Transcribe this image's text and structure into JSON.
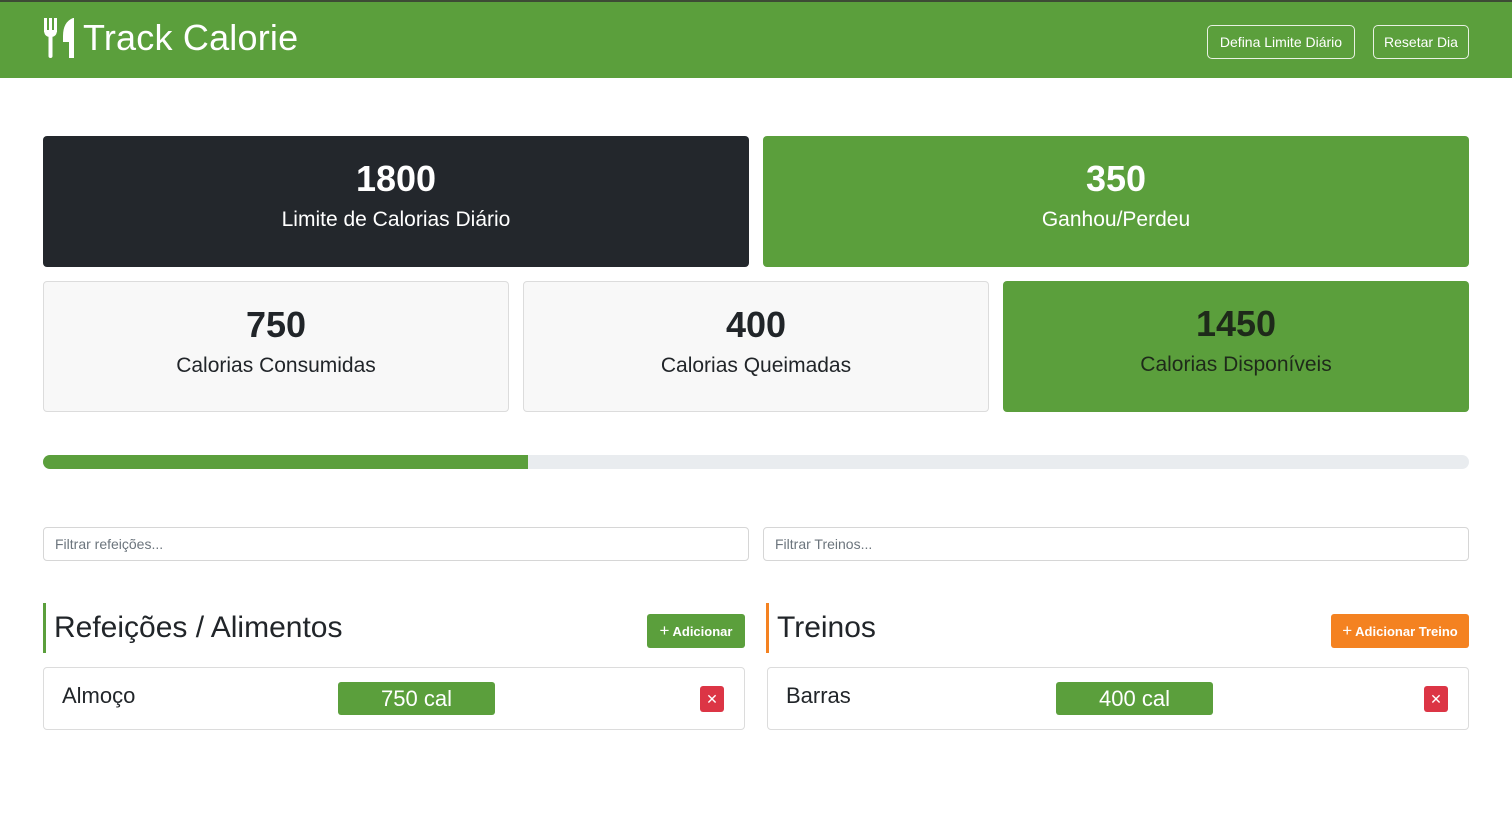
{
  "header": {
    "brand_icon": "utensils-icon",
    "title": "Track Calorie",
    "set_limit_label": "Defina Limite Diário",
    "reset_day_label": "Resetar Dia"
  },
  "stats": {
    "daily_limit": {
      "value": "1800",
      "label": "Limite de Calorias Diário"
    },
    "gain_loss": {
      "value": "350",
      "label": "Ganhou/Perdeu"
    },
    "consumed": {
      "value": "750",
      "label": "Calorias Consumidas"
    },
    "burned": {
      "value": "400",
      "label": "Calorias Queimadas"
    },
    "remaining": {
      "value": "1450",
      "label": "Calorias Disponíveis"
    }
  },
  "progress": {
    "fraction": 0.34
  },
  "filters": {
    "meals_placeholder": "Filtrar refeições...",
    "workouts_placeholder": "Filtrar Treinos..."
  },
  "meals": {
    "title": "Refeições / Alimentos",
    "add_label": "Adicionar",
    "items": [
      {
        "name": "Almoço",
        "calories": "750 cal"
      }
    ]
  },
  "workouts": {
    "title": "Treinos",
    "add_label": "Adicionar Treino",
    "items": [
      {
        "name": "Barras",
        "calories": "400 cal"
      }
    ]
  },
  "colors": {
    "primary_green": "#5b9f3c",
    "dark": "#23272c",
    "orange": "#f48221",
    "danger": "#dc3545"
  }
}
